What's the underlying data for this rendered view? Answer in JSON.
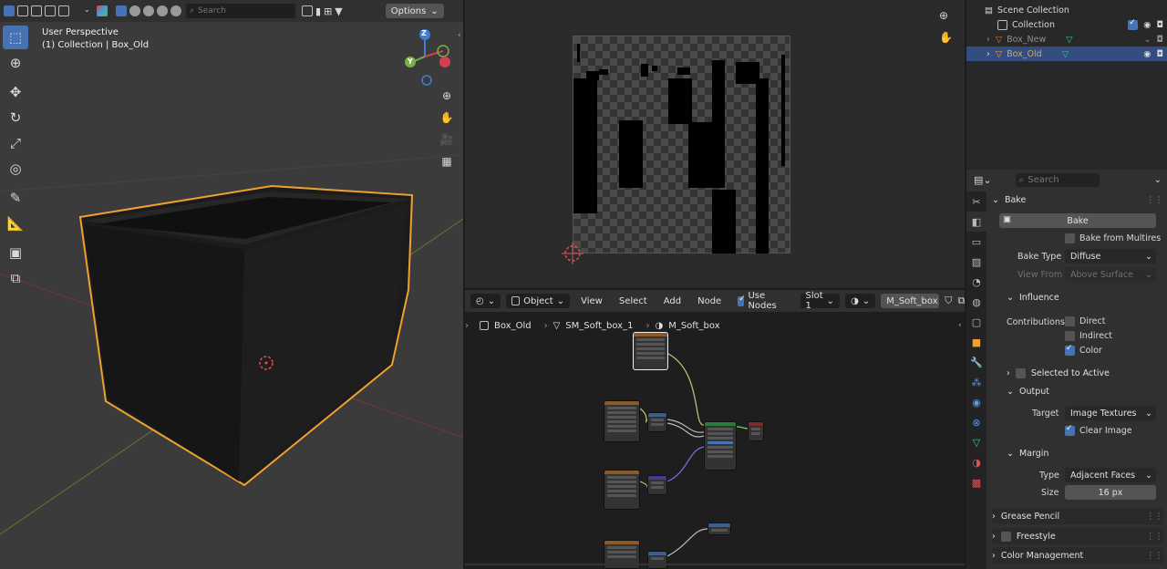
{
  "viewport": {
    "search_placeholder": "Search",
    "options_label": "Options",
    "perspective": "User Perspective",
    "collection_info": "(1) Collection | Box_Old",
    "gizmo": {
      "z": "Z",
      "y": "Y"
    }
  },
  "node_editor": {
    "mode_label": "Object",
    "menu": [
      "View",
      "Select",
      "Add",
      "Node"
    ],
    "use_nodes_label": "Use Nodes",
    "slot_label": "Slot 1",
    "material_name": "M_Soft_box",
    "breadcrumb": [
      "Box_Old",
      "SM_Soft_box_1",
      "M_Soft_box"
    ]
  },
  "outliner": {
    "title": "Scene Collection",
    "rows": [
      {
        "label": "Collection"
      },
      {
        "label": "Box_New"
      },
      {
        "label": "Box_Old"
      }
    ]
  },
  "properties": {
    "search_placeholder": "Search",
    "bake_header": "Bake",
    "bake_button": "Bake",
    "bake_from_multires": "Bake from Multires",
    "bake_type_label": "Bake Type",
    "bake_type_value": "Diffuse",
    "view_from_label": "View From",
    "view_from_value": "Above Surface",
    "influence_header": "Influence",
    "contributions_label": "Contributions",
    "direct": "Direct",
    "indirect": "Indirect",
    "color": "Color",
    "selected_to_active": "Selected to Active",
    "output_header": "Output",
    "target_label": "Target",
    "target_value": "Image Textures",
    "clear_image": "Clear Image",
    "margin_header": "Margin",
    "type_label": "Type",
    "type_value": "Adjacent Faces",
    "size_label": "Size",
    "size_value": "16 px",
    "grease_pencil": "Grease Pencil",
    "freestyle": "Freestyle",
    "color_management": "Color Management"
  },
  "colors": {
    "accent": "#4772b3",
    "selection_outline": "#f0a030",
    "selected_row": "#334d80"
  }
}
